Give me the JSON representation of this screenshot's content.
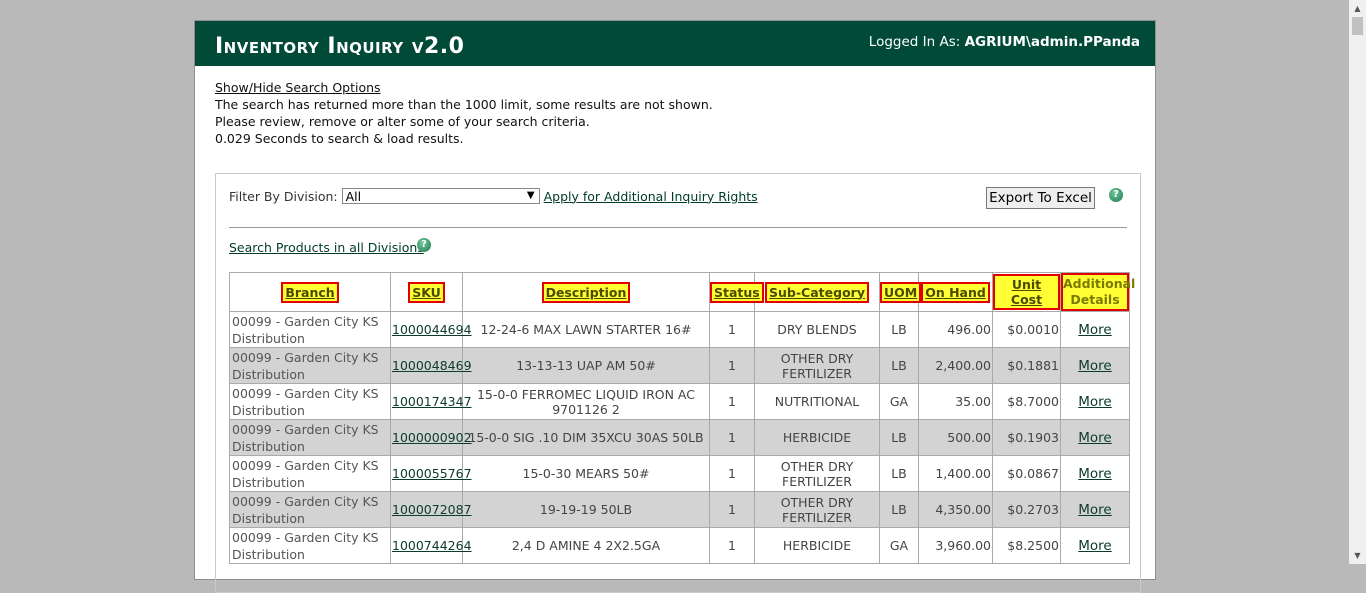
{
  "header": {
    "title": "Inventory Inquiry v2.0",
    "logged_label": "Logged In As:",
    "user": "AGRIUM\\admin.PPanda"
  },
  "info": {
    "toggle_link": "Show/Hide Search Options",
    "line1": "The search has returned more than the 1000 limit, some results are not shown.",
    "line2": "Please review, remove or alter some of your search criteria.",
    "line3": "0.029 Seconds to search & load results."
  },
  "filter": {
    "label": "Filter By Division:",
    "selected": "All",
    "rights_link": "Apply for Additional Inquiry Rights",
    "export_label": "Export To Excel",
    "search_all_link": "Search Products in all Divisions"
  },
  "columns": [
    "Branch",
    "SKU",
    "Description",
    "Status",
    "Sub-Category",
    "UOM",
    "On Hand",
    "Unit Cost",
    "Additional Details"
  ],
  "rows": [
    {
      "branch": "00099 - Garden City KS Distribution",
      "sku": "1000044694",
      "description": "12-24-6 MAX LAWN STARTER 16#",
      "status": "1",
      "subcategory": "DRY BLENDS",
      "uom": "LB",
      "onhand": "496.00",
      "cost": "$0.0010",
      "more": "More"
    },
    {
      "branch": "00099 - Garden City KS Distribution",
      "sku": "1000048469",
      "description": "13-13-13 UAP AM 50#",
      "status": "1",
      "subcategory": "OTHER DRY FERTILIZER",
      "uom": "LB",
      "onhand": "2,400.00",
      "cost": "$0.1881",
      "more": "More"
    },
    {
      "branch": "00099 - Garden City KS Distribution",
      "sku": "1000174347",
      "description": "15-0-0 FERROMEC LIQUID IRON AC 9701126 2",
      "status": "1",
      "subcategory": "NUTRITIONAL",
      "uom": "GA",
      "onhand": "35.00",
      "cost": "$8.7000",
      "more": "More"
    },
    {
      "branch": "00099 - Garden City KS Distribution",
      "sku": "1000000902",
      "description": "15-0-0 SIG .10 DIM 35XCU 30AS 50LB",
      "status": "1",
      "subcategory": "HERBICIDE",
      "uom": "LB",
      "onhand": "500.00",
      "cost": "$0.1903",
      "more": "More"
    },
    {
      "branch": "00099 - Garden City KS Distribution",
      "sku": "1000055767",
      "description": "15-0-30 MEARS 50#",
      "status": "1",
      "subcategory": "OTHER DRY FERTILIZER",
      "uom": "LB",
      "onhand": "1,400.00",
      "cost": "$0.0867",
      "more": "More"
    },
    {
      "branch": "00099 - Garden City KS Distribution",
      "sku": "1000072087",
      "description": "19-19-19 50LB",
      "status": "1",
      "subcategory": "OTHER DRY FERTILIZER",
      "uom": "LB",
      "onhand": "4,350.00",
      "cost": "$0.2703",
      "more": "More"
    },
    {
      "branch": "00099 - Garden City KS Distribution",
      "sku": "1000744264",
      "description": "2,4 D AMINE 4 2X2.5GA",
      "status": "1",
      "subcategory": "HERBICIDE",
      "uom": "GA",
      "onhand": "3,960.00",
      "cost": "$8.2500",
      "more": "More"
    }
  ]
}
